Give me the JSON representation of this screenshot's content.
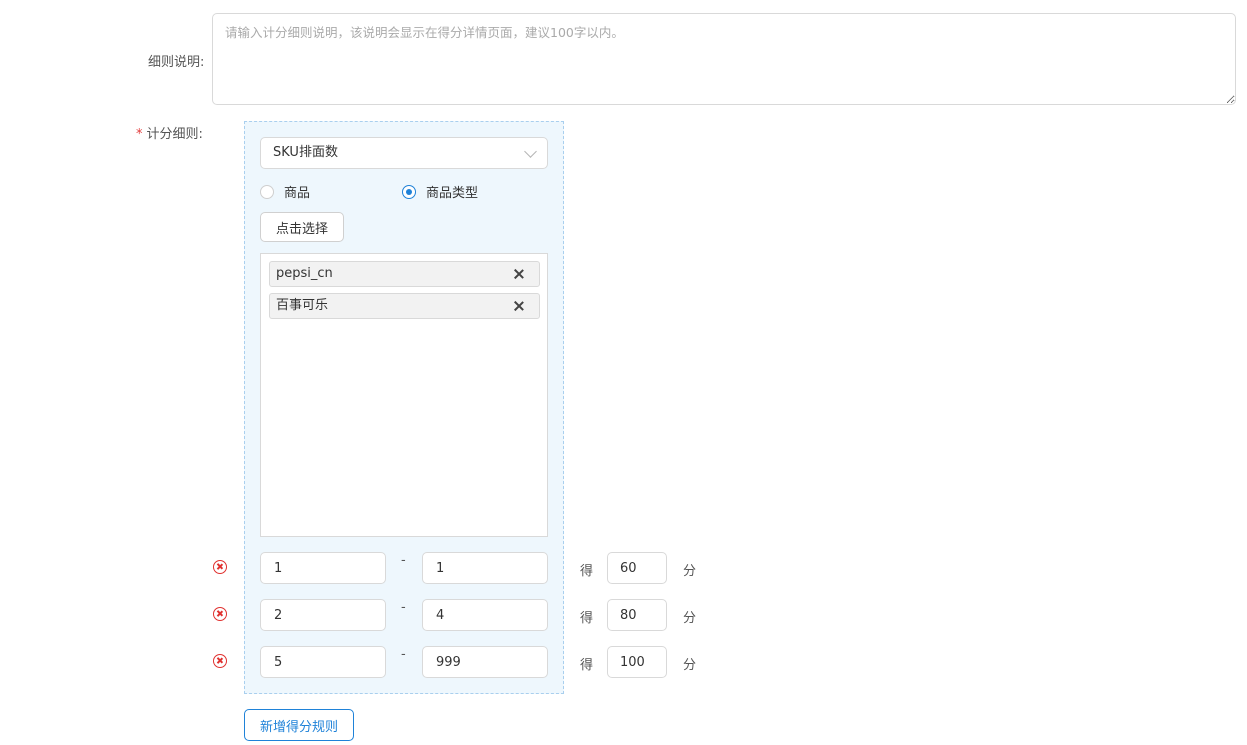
{
  "form": {
    "description_label": "细则说明:",
    "description_placeholder": "请输入计分细则说明，该说明会显示在得分详情页面，建议100字以内。",
    "description_value": "",
    "rules_required_mark": "*",
    "rules_label": "计分细则:"
  },
  "rule": {
    "metric_select_value": "SKU排面数",
    "scope_options": [
      {
        "label": "商品",
        "checked": false
      },
      {
        "label": "商品类型",
        "checked": true
      }
    ],
    "choose_button_label": "点击选择",
    "selected_tags": [
      {
        "label": "pepsi_cn"
      },
      {
        "label": "百事可乐"
      }
    ],
    "score_ranges": [
      {
        "from": "1",
        "to": "1",
        "score": "60"
      },
      {
        "from": "2",
        "to": "4",
        "score": "80"
      },
      {
        "from": "5",
        "to": "999",
        "score": "100"
      }
    ],
    "range_separator": "-",
    "score_prefix": "得",
    "score_suffix": "分"
  },
  "actions": {
    "add_rule_label": "新增得分规则"
  },
  "colors": {
    "accent": "#1f82d8",
    "danger": "#e0312f",
    "panel_bg": "#eef7fd",
    "panel_border": "#a9cfee"
  },
  "icons": [
    "chevron-down-icon",
    "close-icon",
    "remove-circle-icon"
  ]
}
